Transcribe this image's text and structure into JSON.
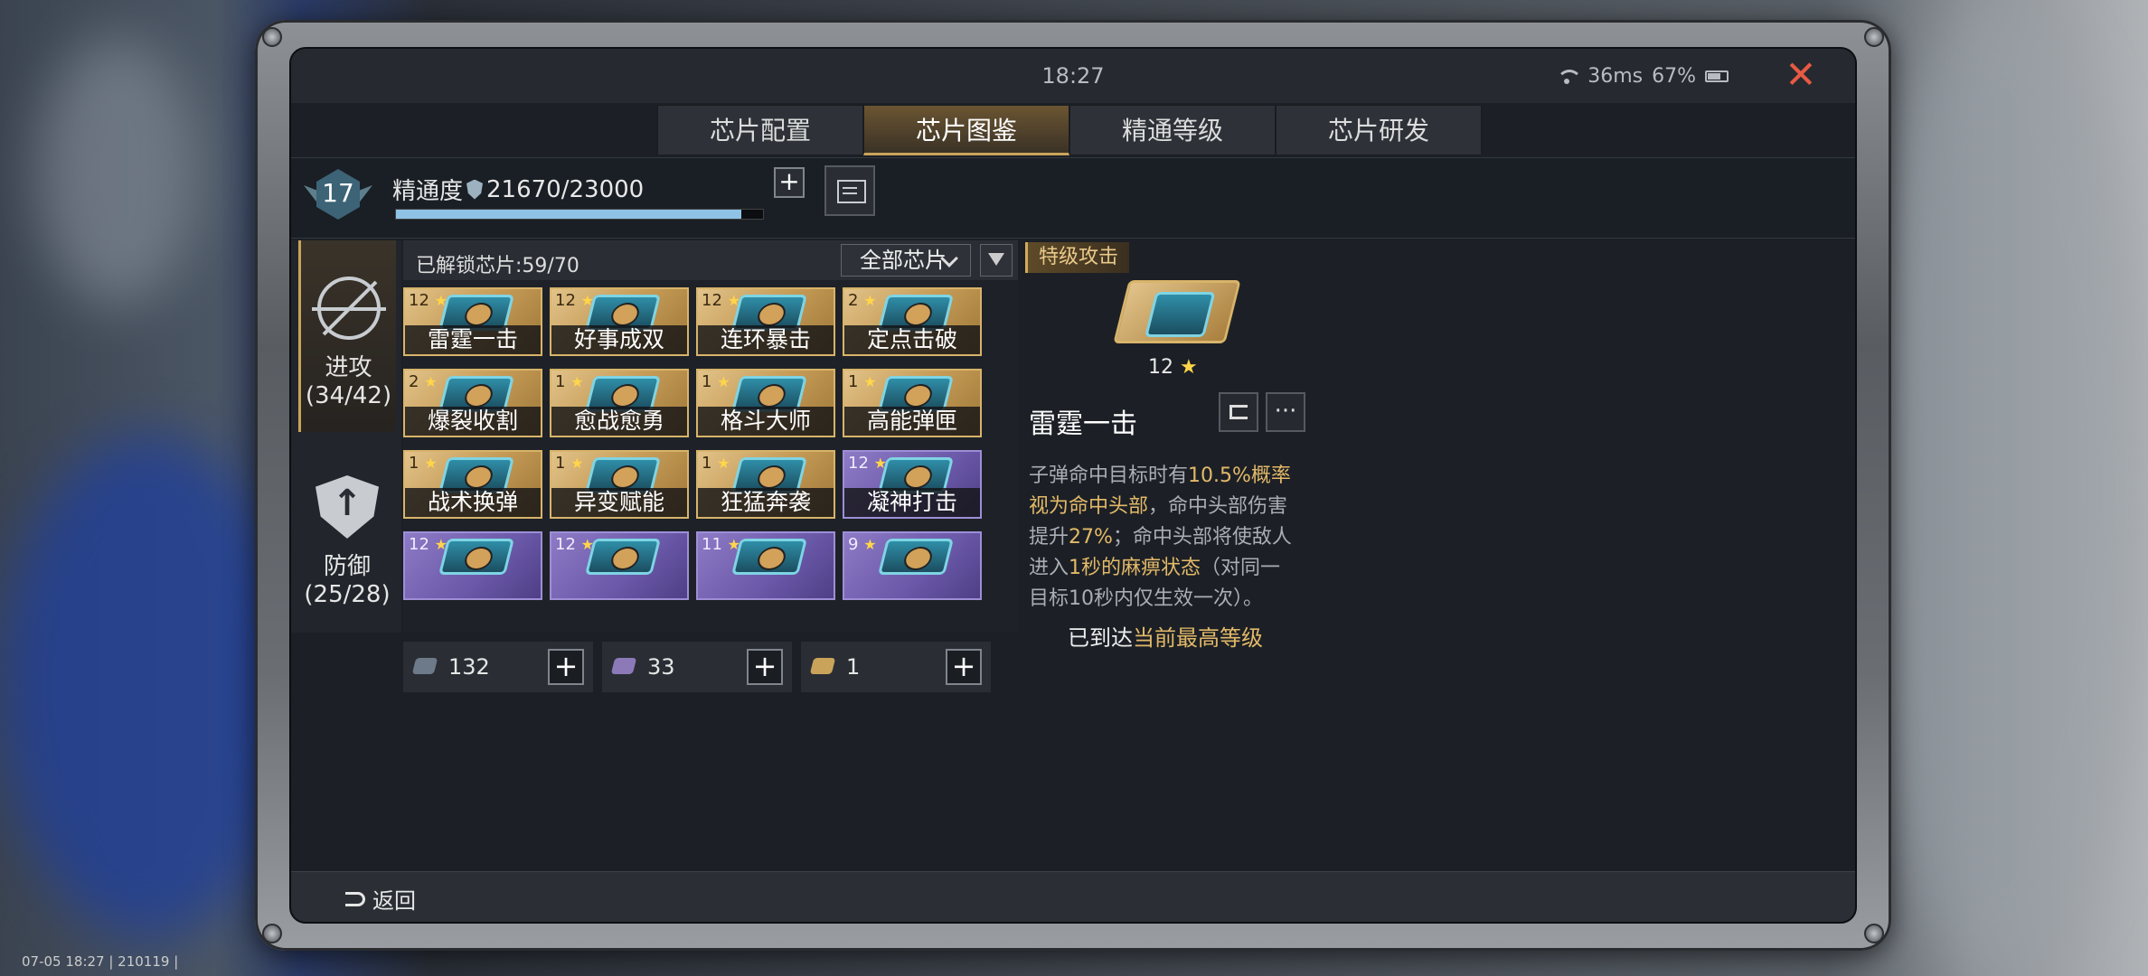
{
  "status": {
    "time": "18:27",
    "ping": "36ms",
    "battery": "67%"
  },
  "tabs": [
    {
      "label": "芯片配置",
      "active": false
    },
    {
      "label": "芯片图鉴",
      "active": true
    },
    {
      "label": "精通等级",
      "active": false
    },
    {
      "label": "芯片研发",
      "active": false
    }
  ],
  "mastery": {
    "level": "17",
    "label": "精通度",
    "value": "21670/23000",
    "progress": 0.942
  },
  "categories": [
    {
      "label": "进攻",
      "count": "(34/42)",
      "icon": "crosshair-icon",
      "active": true
    },
    {
      "label": "防御",
      "count": "(25/28)",
      "icon": "shield-icon",
      "active": false
    }
  ],
  "grid": {
    "unlocked_text": "已解锁芯片:59/70",
    "filter_label": "全部芯片",
    "chips": [
      {
        "level": "12",
        "name": "雷霆一击",
        "rarity": "gold"
      },
      {
        "level": "12",
        "name": "好事成双",
        "rarity": "gold"
      },
      {
        "level": "12",
        "name": "连环暴击",
        "rarity": "gold"
      },
      {
        "level": "2",
        "name": "定点击破",
        "rarity": "gold"
      },
      {
        "level": "2",
        "name": "爆裂收割",
        "rarity": "gold"
      },
      {
        "level": "1",
        "name": "愈战愈勇",
        "rarity": "gold"
      },
      {
        "level": "1",
        "name": "格斗大师",
        "rarity": "gold"
      },
      {
        "level": "1",
        "name": "高能弹匣",
        "rarity": "gold"
      },
      {
        "level": "1",
        "name": "战术换弹",
        "rarity": "gold"
      },
      {
        "level": "1",
        "name": "异变赋能",
        "rarity": "gold"
      },
      {
        "level": "1",
        "name": "狂猛奔袭",
        "rarity": "gold"
      },
      {
        "level": "12",
        "name": "凝神打击",
        "rarity": "purple"
      },
      {
        "level": "12",
        "name": "",
        "rarity": "purple"
      },
      {
        "level": "12",
        "name": "",
        "rarity": "purple"
      },
      {
        "level": "11",
        "name": "",
        "rarity": "purple"
      },
      {
        "level": "9",
        "name": "",
        "rarity": "purple"
      }
    ]
  },
  "resources": [
    {
      "count": "132",
      "icon": "token-icon"
    },
    {
      "count": "33",
      "icon": "token-icon"
    },
    {
      "count": "1",
      "icon": "token-icon"
    }
  ],
  "detail": {
    "tag": "特级攻击",
    "level": "12",
    "name": "雷霆一击",
    "desc_parts": [
      {
        "text": "子弹命中目标时有",
        "hl": false
      },
      {
        "text": "10.5%概率视为命中头部",
        "hl": true
      },
      {
        "text": "，命中头部伤害提升",
        "hl": false
      },
      {
        "text": "27%",
        "hl": true
      },
      {
        "text": "；命中头部将使敌人进入",
        "hl": false
      },
      {
        "text": "1秒的麻痹状态",
        "hl": true
      },
      {
        "text": "（对同一目标10秒内仅生效一次）。",
        "hl": false
      }
    ],
    "max_prefix": "已到达",
    "max_highlight": "当前最高等级"
  },
  "bottom": {
    "back_label": "返回"
  },
  "footer_status": "07-05 18:27 | 210119 |"
}
